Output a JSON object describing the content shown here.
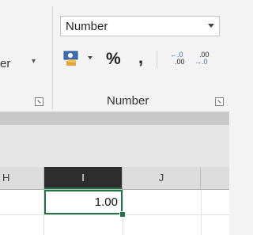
{
  "ribbon": {
    "prev_group_label": "er",
    "number_format": {
      "value": "Number"
    },
    "number_group_label": "Number",
    "percent_label": "%",
    "comma_label": ",",
    "increase_decimal": {
      "top": "←.0",
      "bottom": ".00"
    },
    "decrease_decimal": {
      "top": ".00",
      "bottom": "→.0"
    }
  },
  "grid": {
    "columns": [
      "H",
      "I",
      "J"
    ],
    "selected_column": "I",
    "active_cell_value": "1.00"
  },
  "colors": {
    "accent": "#217346",
    "selected_header": "#2d2d2d"
  }
}
